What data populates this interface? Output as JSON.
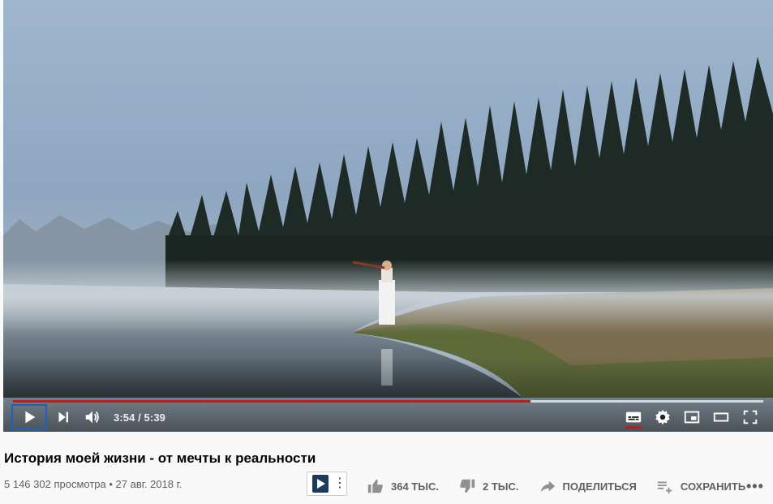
{
  "player": {
    "current_time": "3:54",
    "duration": "5:39",
    "time_display": "3:54 / 5:39",
    "progress_played_fraction": 0.69,
    "progress_loaded_fraction": 1.0,
    "accent_color": "#ff0000",
    "icons": [
      "play-icon",
      "next-icon",
      "volume-icon",
      "subtitles-icon",
      "settings-icon",
      "miniplayer-icon",
      "theater-icon",
      "fullscreen-icon"
    ]
  },
  "video": {
    "title": "История моей жизни - от мечты к реальности",
    "views": "5 146 302 просмотра",
    "separator": "•",
    "date": "27 авг. 2018 г.",
    "meta_line": "5 146 302 просмотра • 27 авг. 2018 г."
  },
  "actions": {
    "like_count": "364 ТЫС.",
    "dislike_count": "2 ТЫС.",
    "share_label": "ПОДЕЛИТЬСЯ",
    "save_label": "СОХРАНИТЬ",
    "more_label": "•••"
  }
}
